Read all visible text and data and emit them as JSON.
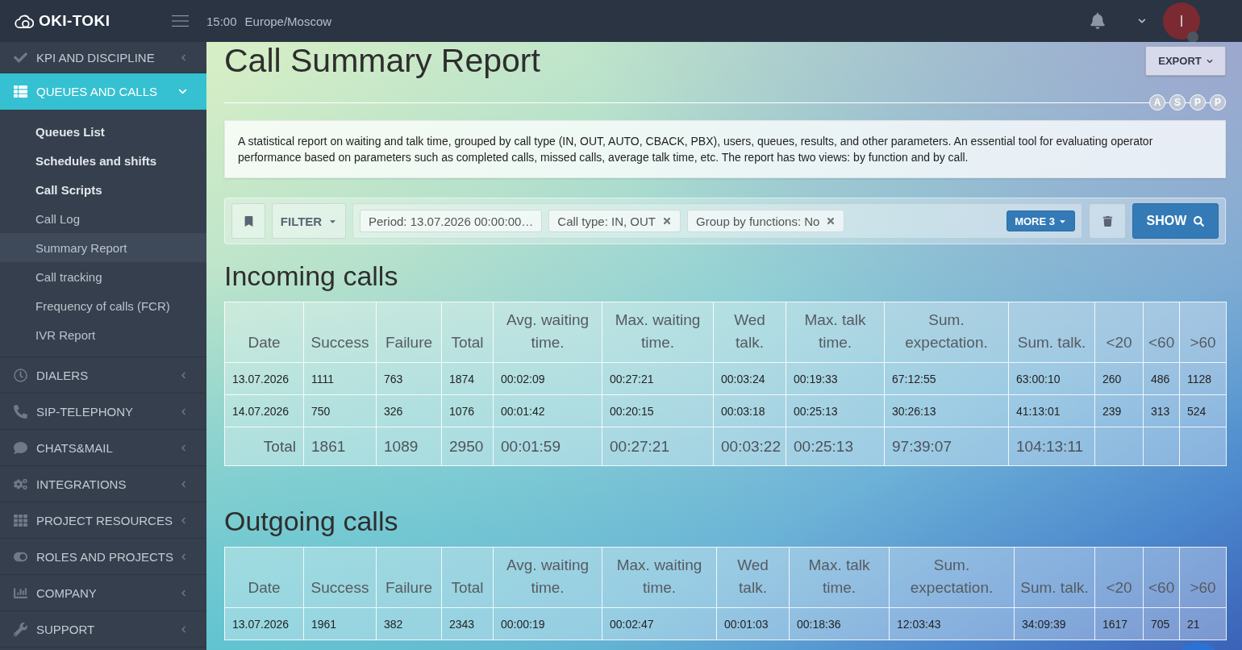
{
  "topbar": {
    "brand": "OKI-TOKI",
    "time": "15:00",
    "timezone": "Europe/Moscow",
    "avatar": "I"
  },
  "sidebar": {
    "groups": [
      {
        "label": "KPI AND DISCIPLINE",
        "selected": false,
        "expanded": false
      },
      {
        "label": "QUEUES AND CALLS",
        "selected": true,
        "expanded": true,
        "children": [
          {
            "label": "Queues List",
            "emphasized": true,
            "selected": false
          },
          {
            "label": "Schedules and shifts",
            "emphasized": true,
            "selected": false
          },
          {
            "label": "Call Scripts",
            "emphasized": true,
            "selected": false
          },
          {
            "label": "Call Log",
            "emphasized": false,
            "selected": false
          },
          {
            "label": "Summary Report",
            "emphasized": false,
            "selected": true
          },
          {
            "label": "Call tracking",
            "emphasized": false,
            "selected": false
          },
          {
            "label": "Frequency of calls (FCR)",
            "emphasized": false,
            "selected": false
          },
          {
            "label": "IVR Report",
            "emphasized": false,
            "selected": false
          }
        ]
      },
      {
        "label": "DIALERS",
        "selected": false,
        "expanded": false
      },
      {
        "label": "SIP-TELEPHONY",
        "selected": false,
        "expanded": false
      },
      {
        "label": "CHATS&MAIL",
        "selected": false,
        "expanded": false
      },
      {
        "label": "INTEGRATIONS",
        "selected": false,
        "expanded": false
      },
      {
        "label": "PROJECT RESOURCES",
        "selected": false,
        "expanded": false
      },
      {
        "label": "ROLES AND PROJECTS",
        "selected": false,
        "expanded": false
      },
      {
        "label": "COMPANY",
        "selected": false,
        "expanded": false
      },
      {
        "label": "SUPPORT",
        "selected": false,
        "expanded": false
      }
    ]
  },
  "page": {
    "title": "Call Summary Report",
    "export_button": "EXPORT",
    "steps": [
      "A",
      "S",
      "P",
      "P"
    ],
    "description": "A statistical report on waiting and talk time, grouped by call type (IN, OUT, AUTO, CBACK, PBX), users, queues, results, and other parameters. An essential tool for evaluating operator performance based on parameters such as completed calls, missed calls, average talk time, etc. The report has two views: by function and by call."
  },
  "filters": {
    "filter_button": "FILTER",
    "chips": [
      {
        "label": "Period: 13.07.2026 00:00:00…",
        "removable": false
      },
      {
        "label": "Call type: IN, OUT",
        "removable": true
      },
      {
        "label": "Group by functions: No",
        "removable": true
      }
    ],
    "more_button": "MORE 3",
    "show_button": "SHOW"
  },
  "sections": [
    {
      "title": "Incoming calls",
      "table": {
        "columns": [
          "Date",
          "Success",
          "Failure",
          "Total",
          "Avg. waiting time.",
          "Max. waiting time.",
          "Wed talk.",
          "Max. talk time.",
          "Sum. expectation.",
          "Sum. talk.",
          "<20",
          "<60",
          ">60"
        ],
        "rows": [
          [
            "13.07.2026",
            "1111",
            "763",
            "1874",
            "00:02:09",
            "00:27:21",
            "00:03:24",
            "00:19:33",
            "67:12:55",
            "63:00:10",
            "260",
            "486",
            "1128"
          ],
          [
            "14.07.2026",
            "750",
            "326",
            "1076",
            "00:01:42",
            "00:20:15",
            "00:03:18",
            "00:25:13",
            "30:26:13",
            "41:13:01",
            "239",
            "313",
            "524"
          ]
        ],
        "total": [
          "Total",
          "1861",
          "1089",
          "2950",
          "00:01:59",
          "00:27:21",
          "00:03:22",
          "00:25:13",
          "97:39:07",
          "104:13:11"
        ]
      }
    },
    {
      "title": "Outgoing calls",
      "table": {
        "columns": [
          "Date",
          "Success",
          "Failure",
          "Total",
          "Avg. waiting time.",
          "Max. waiting time.",
          "Wed talk.",
          "Max. talk time.",
          "Sum. expectation.",
          "Sum. talk.",
          "<20",
          "<60",
          ">60"
        ],
        "rows": [
          [
            "13.07.2026",
            "1961",
            "382",
            "2343",
            "00:00:19",
            "00:02:47",
            "00:01:03",
            "00:18:36",
            "12:03:43",
            "34:09:39",
            "1617",
            "705",
            "21"
          ]
        ]
      }
    }
  ]
}
